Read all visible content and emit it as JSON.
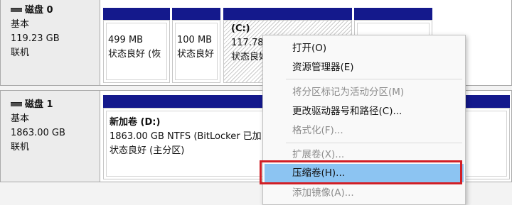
{
  "disk0": {
    "name": "磁盘 0",
    "type": "基本",
    "size": "119.23 GB",
    "status": "联机",
    "partitions": [
      {
        "size": "499 MB",
        "status": "状态良好 (恢"
      },
      {
        "size": "100 MB",
        "status": "状态良好"
      },
      {
        "label": "(C:)",
        "size": "117.78",
        "status": "状态良好"
      },
      {
        "size": "",
        "status": ""
      }
    ]
  },
  "disk1": {
    "name": "磁盘 1",
    "type": "基本",
    "size": "1863.00 GB",
    "status": "联机",
    "partition": {
      "label": "新加卷 (D:)",
      "detail": "1863.00 GB NTFS (BitLocker 已加",
      "status": "状态良好 (主分区)"
    }
  },
  "context_menu": {
    "items": [
      {
        "label": "打开(O)",
        "enabled": true
      },
      {
        "label": "资源管理器(E)",
        "enabled": true
      },
      {
        "label": "将分区标记为活动分区(M)",
        "enabled": false
      },
      {
        "label": "更改驱动器号和路径(C)...",
        "enabled": true
      },
      {
        "label": "格式化(F)...",
        "enabled": false
      },
      {
        "label": "扩展卷(X)...",
        "enabled": false
      },
      {
        "label": "压缩卷(H)...",
        "enabled": true,
        "highlighted": true
      },
      {
        "label": "添加镜像(A)...",
        "enabled": false
      }
    ]
  },
  "colors": {
    "partition_bar": "#14198c",
    "highlight": "#8cc4f2",
    "annotation_box": "#d11f26"
  }
}
